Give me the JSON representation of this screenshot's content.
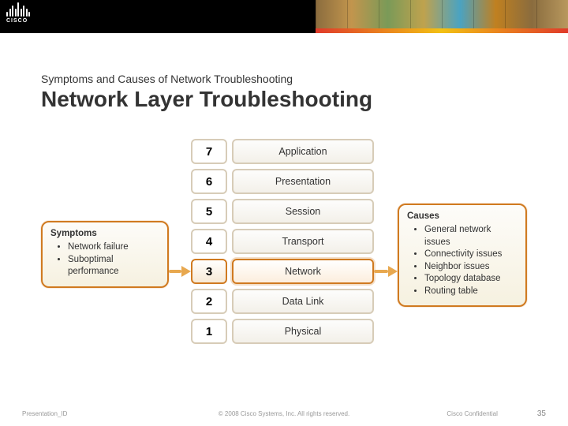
{
  "logo_text": "CISCO",
  "subtitle": "Symptoms and Causes of Network Troubleshooting",
  "title": "Network Layer Troubleshooting",
  "layers": [
    {
      "num": "7",
      "name": "Application"
    },
    {
      "num": "6",
      "name": "Presentation"
    },
    {
      "num": "5",
      "name": "Session"
    },
    {
      "num": "4",
      "name": "Transport"
    },
    {
      "num": "3",
      "name": "Network"
    },
    {
      "num": "2",
      "name": "Data Link"
    },
    {
      "num": "1",
      "name": "Physical"
    }
  ],
  "symptoms": {
    "header": "Symptoms",
    "items": [
      "Network failure",
      "Suboptimal performance"
    ]
  },
  "causes": {
    "header": "Causes",
    "items": [
      "General network issues",
      "Connectivity issues",
      "Neighbor issues",
      "Topology database",
      "Routing table"
    ]
  },
  "footer": {
    "left": "Presentation_ID",
    "mid": "© 2008 Cisco Systems, Inc. All rights reserved.",
    "right": "Cisco Confidential",
    "page": "35"
  }
}
